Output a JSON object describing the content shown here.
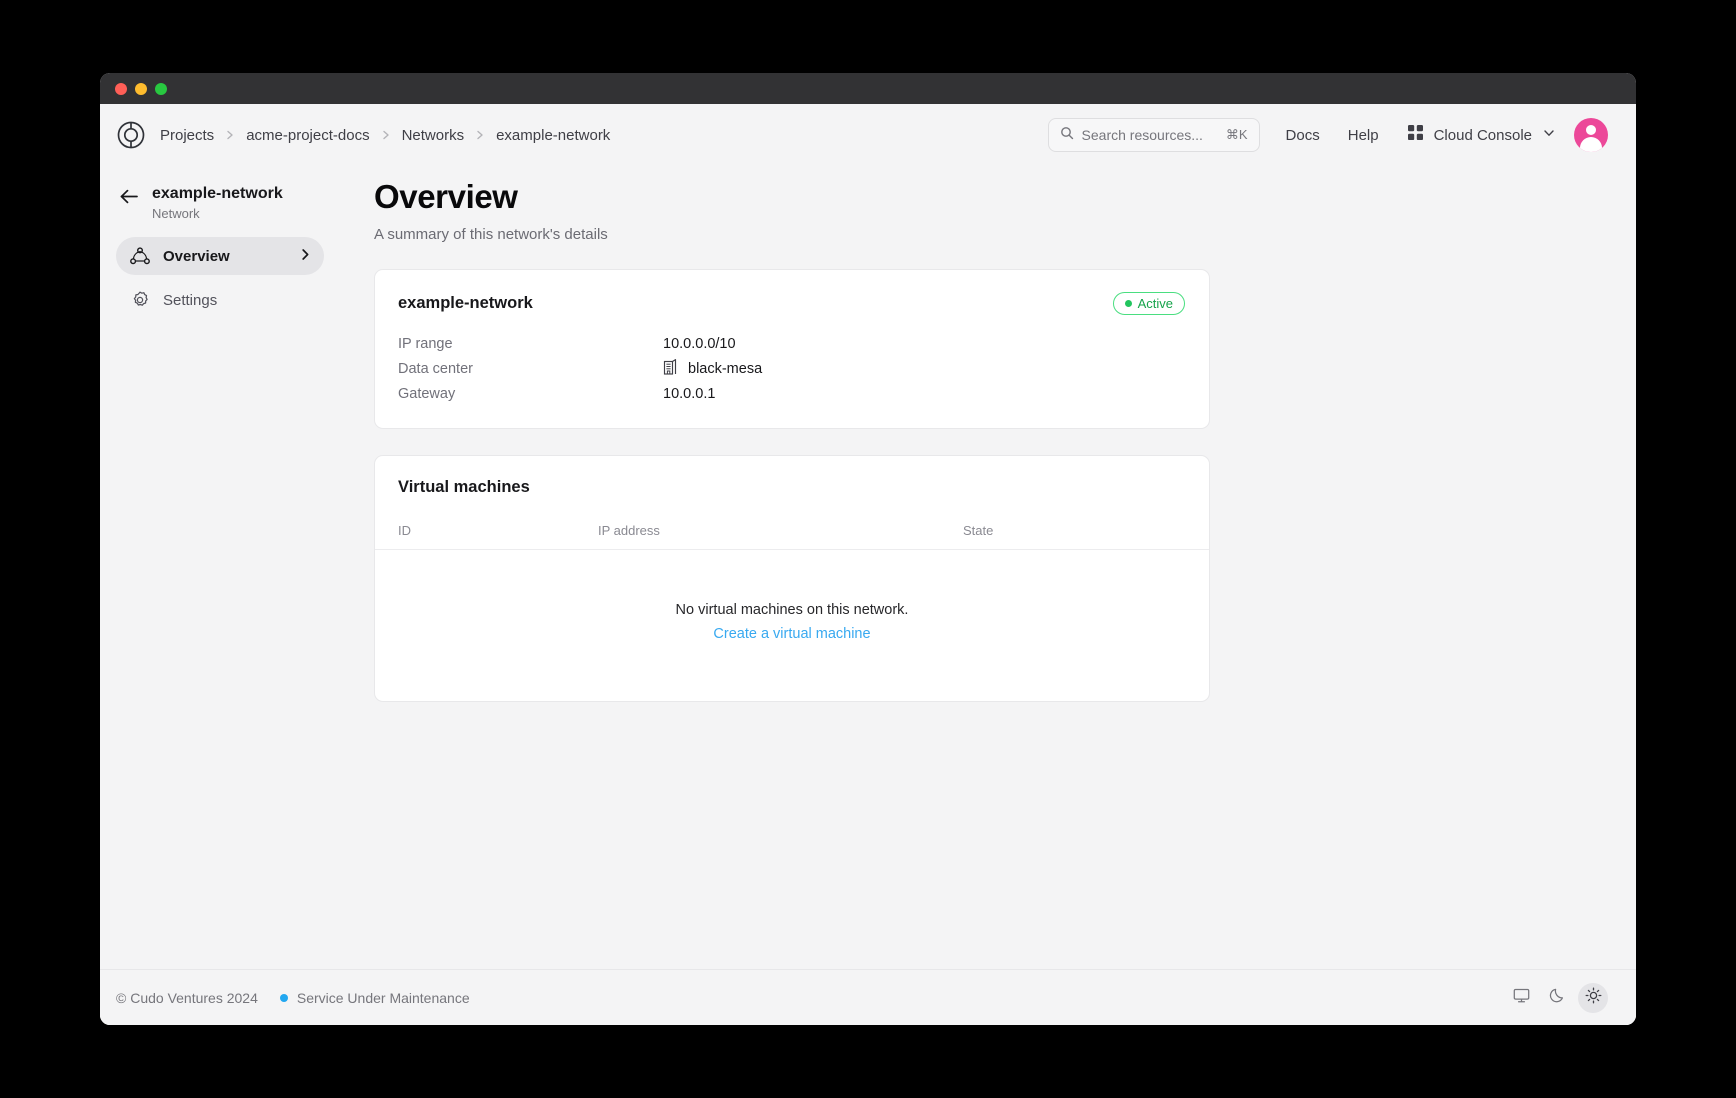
{
  "window": {
    "traffic_lights": [
      "close",
      "minimize",
      "maximize"
    ]
  },
  "topbar": {
    "logo_icon": "cudo-logo-icon",
    "breadcrumb": [
      {
        "label": "Projects"
      },
      {
        "label": "acme-project-docs"
      },
      {
        "label": "Networks"
      },
      {
        "label": "example-network"
      }
    ],
    "search": {
      "icon": "search-icon",
      "placeholder": "Search resources...",
      "shortcut": "⌘K",
      "value": ""
    },
    "docs_label": "Docs",
    "help_label": "Help",
    "console_switcher": {
      "grid_icon": "grid-apps-icon",
      "label": "Cloud Console",
      "chevron_icon": "chevron-down-icon"
    },
    "avatar": {
      "icon": "user-avatar-icon",
      "color": "#ec4899"
    }
  },
  "sidebar": {
    "back_icon": "arrow-left-icon",
    "title": "example-network",
    "subtitle": "Network",
    "items": [
      {
        "label": "Overview",
        "icon": "network-topology-icon",
        "active": true,
        "chevron": "chevron-right-icon"
      },
      {
        "label": "Settings",
        "icon": "gear-icon",
        "active": false,
        "chevron": ""
      }
    ]
  },
  "main": {
    "page_title": "Overview",
    "page_subtitle": "A summary of this network's details",
    "network_card": {
      "title": "example-network",
      "status": {
        "label": "Active",
        "dot_color": "#22c55e",
        "text_color": "#16a34a",
        "border_color": "#4ade80"
      },
      "details": [
        {
          "key": "IP range",
          "value": "10.0.0.0/10",
          "icon": ""
        },
        {
          "key": "Data center",
          "value": "black-mesa",
          "icon": "datacenter-building-icon"
        },
        {
          "key": "Gateway",
          "value": "10.0.0.1",
          "icon": ""
        }
      ]
    },
    "vm_card": {
      "title": "Virtual machines",
      "columns": [
        "ID",
        "IP address",
        "State"
      ],
      "rows": [],
      "empty_text": "No virtual machines on this network.",
      "empty_link": "Create a virtual machine",
      "empty_link_color": "#38a9f0"
    }
  },
  "footer": {
    "copyright": "© Cudo Ventures 2024",
    "status_text": "Service Under Maintenance",
    "status_dot_color": "#22a7f0",
    "theme_buttons": [
      {
        "icon": "monitor-icon",
        "name": "system-theme",
        "selected": false
      },
      {
        "icon": "moon-icon",
        "name": "dark-theme",
        "selected": false
      },
      {
        "icon": "sun-icon",
        "name": "light-theme",
        "selected": true
      }
    ]
  }
}
